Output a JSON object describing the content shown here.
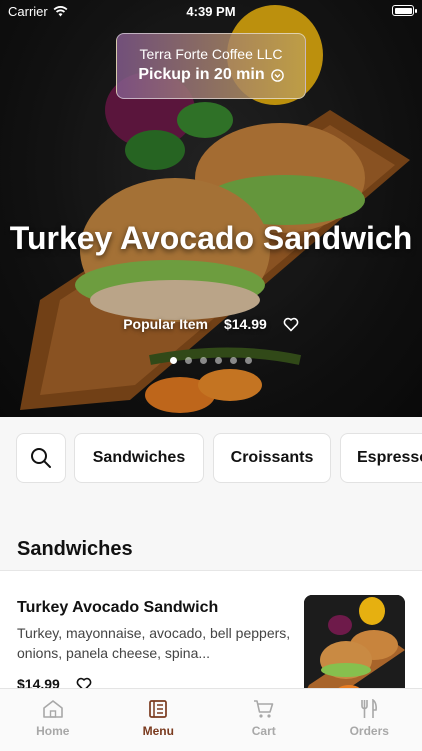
{
  "status_bar": {
    "carrier": "Carrier",
    "time": "4:39 PM"
  },
  "store": {
    "name": "Terra Forte Coffee LLC",
    "pickup": "Pickup in 20 min"
  },
  "hero": {
    "title": "Turkey Avocado Sandwich",
    "tag": "Popular Item",
    "price": "$14.99",
    "slide_count": 6,
    "active_slide": 1
  },
  "categories": {
    "search_icon": "search-icon",
    "items": [
      "Sandwiches",
      "Croissants",
      "Espresso"
    ]
  },
  "section": {
    "title": "Sandwiches"
  },
  "menu_items": [
    {
      "name": "Turkey Avocado Sandwich",
      "description": "Turkey, mayonnaise, avocado, bell peppers, onions, panela cheese, spina...",
      "price": "$14.99"
    }
  ],
  "tabs": [
    {
      "label": "Home",
      "icon": "home-icon"
    },
    {
      "label": "Menu",
      "icon": "menu-icon"
    },
    {
      "label": "Cart",
      "icon": "cart-icon"
    },
    {
      "label": "Orders",
      "icon": "fork-knife-icon"
    }
  ],
  "colors": {
    "accent": "#7a3a1e",
    "tab_inactive": "#a8a8a8",
    "category_bg": "#f7f7f7"
  }
}
